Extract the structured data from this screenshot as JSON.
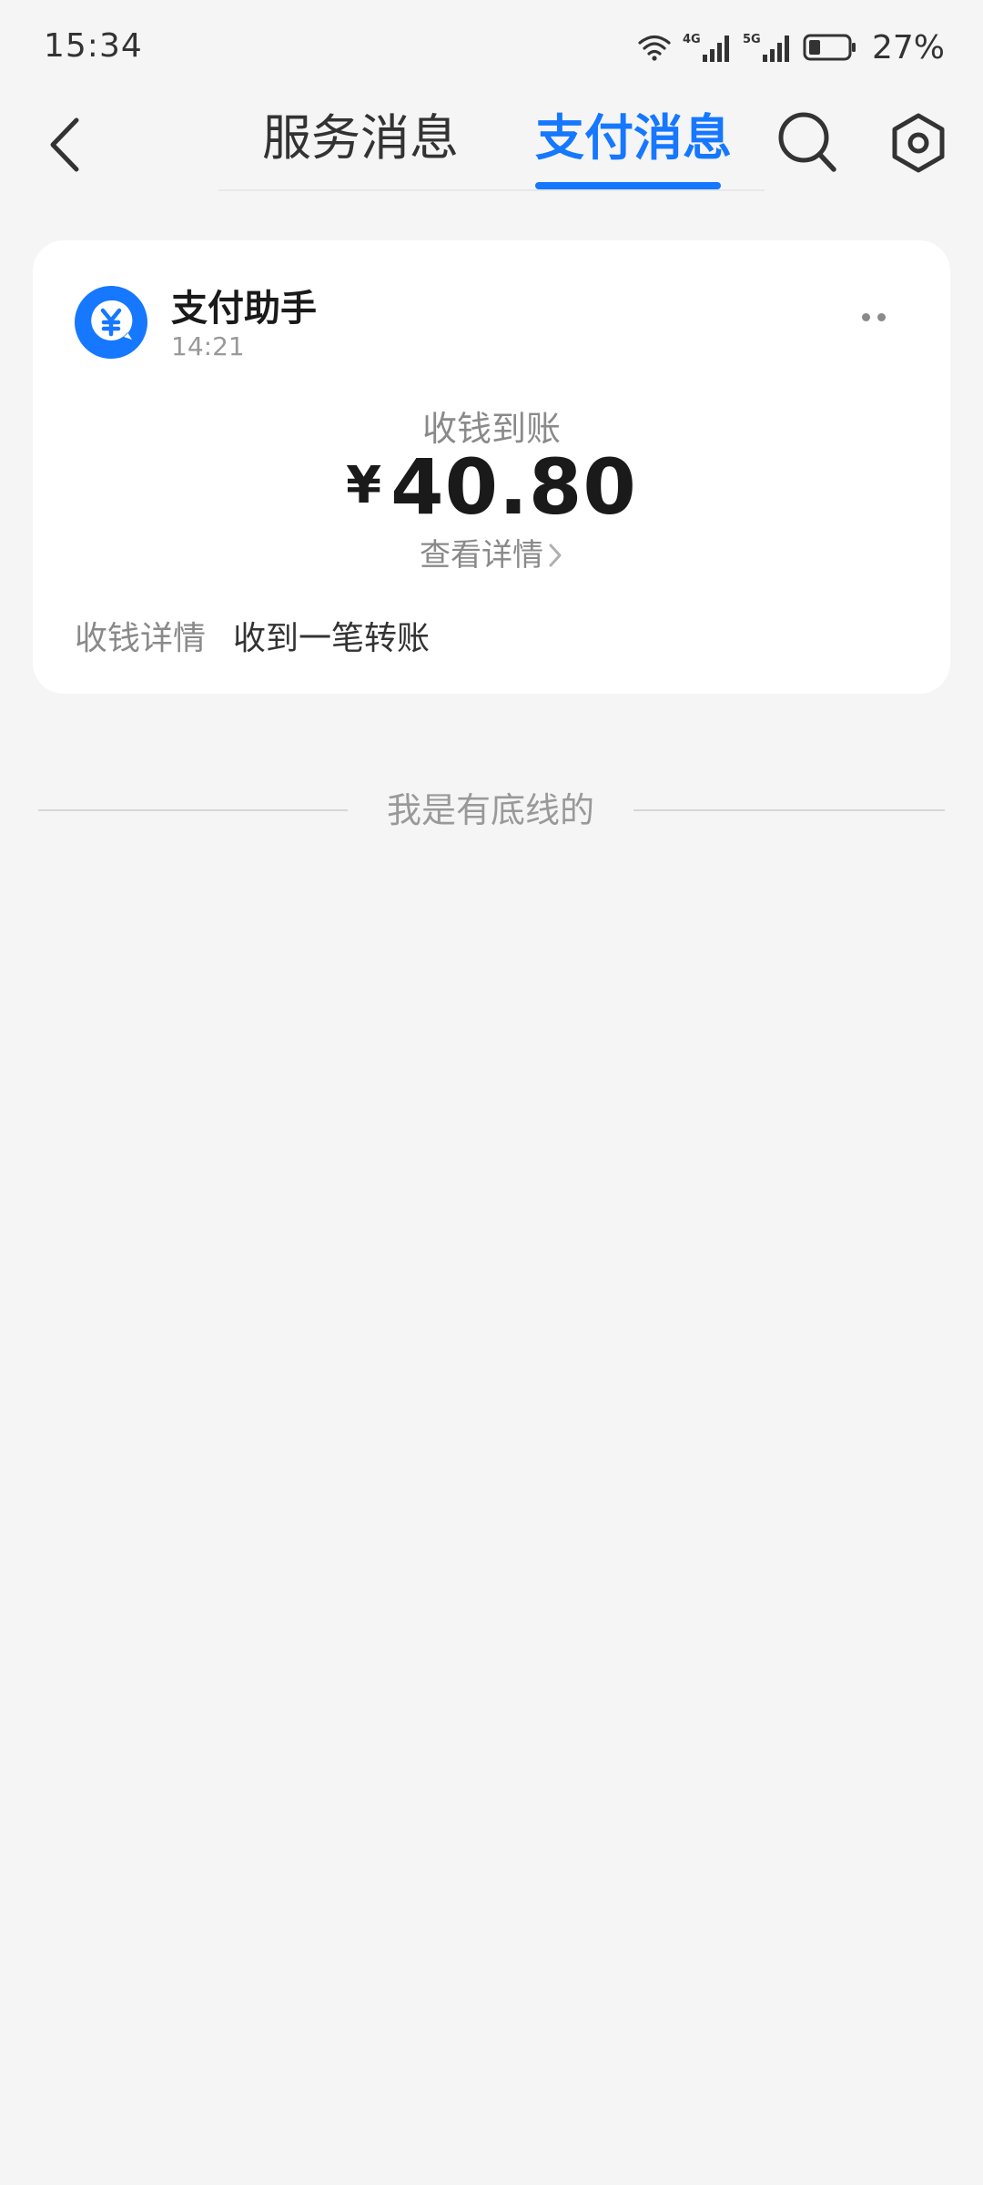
{
  "status_bar": {
    "time": "15:34",
    "network_1": "4G",
    "network_2": "5G",
    "battery": "27%"
  },
  "nav": {
    "tabs": [
      {
        "label": "服务消息",
        "active": false
      },
      {
        "label": "支付消息",
        "active": true
      }
    ],
    "accent_color": "#1677ff"
  },
  "message": {
    "sender": "支付助手",
    "time": "14:21",
    "title": "收钱到账",
    "currency": "¥",
    "amount": "40.80",
    "detail_link": "查看详情",
    "detail_key": "收钱详情",
    "detail_value": "收到一笔转账"
  },
  "footer": {
    "end_text": "我是有底线的"
  },
  "icons": [
    "back-arrow-icon",
    "search-icon",
    "gear-icon",
    "more-dots-icon",
    "yuan-chat-icon",
    "chevron-right-icon",
    "wifi-icon",
    "signal-icon",
    "battery-icon"
  ]
}
